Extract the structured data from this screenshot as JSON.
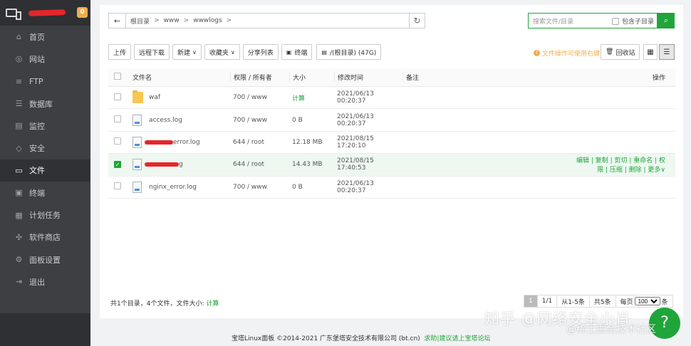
{
  "sidebar": {
    "badge": "0",
    "items": [
      {
        "label": "首页",
        "icon": "home-icon",
        "glyph": "⌂"
      },
      {
        "label": "网站",
        "icon": "globe-icon",
        "glyph": "◎"
      },
      {
        "label": "FTP",
        "icon": "ftp-icon",
        "glyph": "≡"
      },
      {
        "label": "数据库",
        "icon": "database-icon",
        "glyph": "☰"
      },
      {
        "label": "监控",
        "icon": "monitor-icon",
        "glyph": "▤"
      },
      {
        "label": "安全",
        "icon": "shield-icon",
        "glyph": "◇"
      },
      {
        "label": "文件",
        "icon": "folder-icon",
        "glyph": "▭"
      },
      {
        "label": "终端",
        "icon": "terminal-icon",
        "glyph": "▣"
      },
      {
        "label": "计划任务",
        "icon": "calendar-icon",
        "glyph": "▦"
      },
      {
        "label": "软件商店",
        "icon": "store-icon",
        "glyph": "✣"
      },
      {
        "label": "面板设置",
        "icon": "gear-icon",
        "glyph": "⚙"
      },
      {
        "label": "退出",
        "icon": "logout-icon",
        "glyph": "⇥"
      }
    ],
    "active_index": 6
  },
  "path": {
    "crumbs": [
      "根目录",
      "www",
      "wwwlogs"
    ]
  },
  "search": {
    "placeholder": "搜索文件/目录",
    "include_sub_label": "包含子目录"
  },
  "toolbar": {
    "upload": "上传",
    "remote_download": "远程下载",
    "new": "新建",
    "favorites": "收藏夹",
    "share_list": "分享列表",
    "terminal": "终端",
    "disk": "/(根目录) (47G)",
    "hint": "文件操作可使用右键",
    "recycle": "回收站"
  },
  "table": {
    "headers": {
      "name": "文件名",
      "perm": "权限 / 所有者",
      "size": "大小",
      "time": "修改时间",
      "note": "备注",
      "op": "操作"
    },
    "rows": [
      {
        "name": "waf",
        "type": "folder",
        "perm": "700 / www",
        "size": "计算",
        "time": "2021/06/13 00:20:37",
        "checked": false
      },
      {
        "name": "access.log",
        "type": "file",
        "perm": "700 / www",
        "size": "0 B",
        "time": "2021/06/13 00:20:37",
        "checked": false
      },
      {
        "name": "error.log",
        "type": "file",
        "perm": "644 / root",
        "size": "12.18 MB",
        "time": "2021/08/15 17:20:10",
        "checked": false
      },
      {
        "name": "g",
        "type": "file",
        "perm": "644 / root",
        "size": "14.43 MB",
        "time": "2021/08/15 17:40:53",
        "checked": true
      },
      {
        "name": "nginx_error.log",
        "type": "file",
        "perm": "700 / www",
        "size": "0 B",
        "time": "2021/06/13 00:20:37",
        "checked": false
      }
    ],
    "row_ops": "编辑 | 复制 | 剪切 | 重命名 | 权限 | 压缩 | 删除 | 更多"
  },
  "footer": {
    "summary": "共1个目录，4个文件，文件大小:",
    "summary_link": "计算",
    "pager": {
      "current": "1",
      "pages": "1/1",
      "range": "从1-5条",
      "total": "共5条",
      "per_page_label": "每页",
      "per_page": "100",
      "unit": "条"
    }
  },
  "copyright": {
    "text": "宝塔Linux面板 ©2014-2021 广东堡塔安全技术有限公司 (bt.cn)",
    "link": "求助|建议请上宝塔论坛"
  },
  "watermark": {
    "line1": "知乎 @网络安全小肖",
    "line2": "@稀土掘金技术社区"
  },
  "colors": {
    "accent": "#20a53a",
    "sidebar_bg": "#3d3f42",
    "warning": "#f0ad4e",
    "redaction": "#e5262b"
  }
}
